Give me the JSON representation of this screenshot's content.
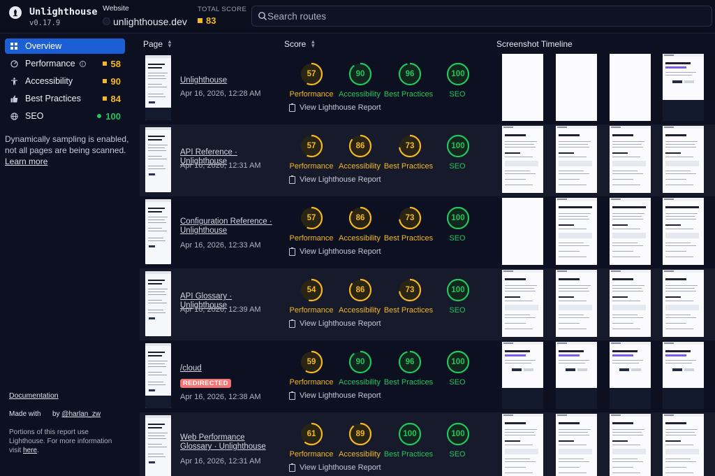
{
  "header": {
    "brand_name": "Unlighthouse",
    "version": "v0.17.9",
    "website_label": "Website",
    "website_url": "unlighthouse.dev",
    "total_score_label": "TOTAL SCORE",
    "total_score": "83",
    "search_placeholder": "Search routes"
  },
  "colors": {
    "orange": "#f3b822",
    "green": "#22c55e",
    "accent": "#1c5fd4",
    "badge_red": "#f47272"
  },
  "sidebar": {
    "items": [
      {
        "label": "Overview",
        "icon": "grid-icon",
        "score": ""
      },
      {
        "label": "Performance",
        "icon": "gauge-icon",
        "score": "58"
      },
      {
        "label": "Accessibility",
        "icon": "accessibility-icon",
        "score": "90"
      },
      {
        "label": "Best Practices",
        "icon": "thumbs-up-icon",
        "score": "84"
      },
      {
        "label": "SEO",
        "icon": "globe-icon",
        "score": "100"
      }
    ],
    "notice_text": "Dynamically sampling is enabled, not all pages are being scanned.",
    "learn_more": "Learn more",
    "documentation": "Documentation",
    "made_with": "Made with",
    "made_by_prefix": "by ",
    "made_by_handle": "@harlan_zw",
    "portions_text": "Portions of this report use Lighthouse. For more information visit ",
    "portions_link": "here",
    "portions_end": "."
  },
  "table": {
    "columns": [
      "Page",
      "Score",
      "Screenshot Timeline"
    ],
    "category_labels": [
      "Performance",
      "Accessibility",
      "Best Practices",
      "SEO"
    ],
    "report_link_label": "View Lighthouse Report",
    "rows": [
      {
        "title": "Unlighthouse",
        "date": "Apr 16, 2026, 12:28 AM",
        "badge": "",
        "scores": [
          57,
          90,
          96,
          100
        ]
      },
      {
        "title": "API Reference · Unlighthouse",
        "date": "Apr 16, 2026, 12:31 AM",
        "badge": "",
        "scores": [
          57,
          86,
          73,
          100
        ]
      },
      {
        "title": "Configuration Reference · Unlighthouse",
        "date": "Apr 16, 2026, 12:33 AM",
        "badge": "",
        "scores": [
          57,
          86,
          73,
          100
        ]
      },
      {
        "title": "API Glossary · Unlighthouse",
        "date": "Apr 16, 2026, 12:39 AM",
        "badge": "",
        "scores": [
          54,
          86,
          73,
          100
        ]
      },
      {
        "title": "/cloud",
        "date": "Apr 16, 2026, 12:38 AM",
        "badge": "REDIRECTED",
        "scores": [
          59,
          90,
          96,
          100
        ]
      },
      {
        "title": "Web Performance Glossary · Unlighthouse",
        "date": "Apr 16, 2026, 12:31 AM",
        "badge": "",
        "scores": [
          61,
          89,
          100,
          100
        ]
      }
    ]
  }
}
